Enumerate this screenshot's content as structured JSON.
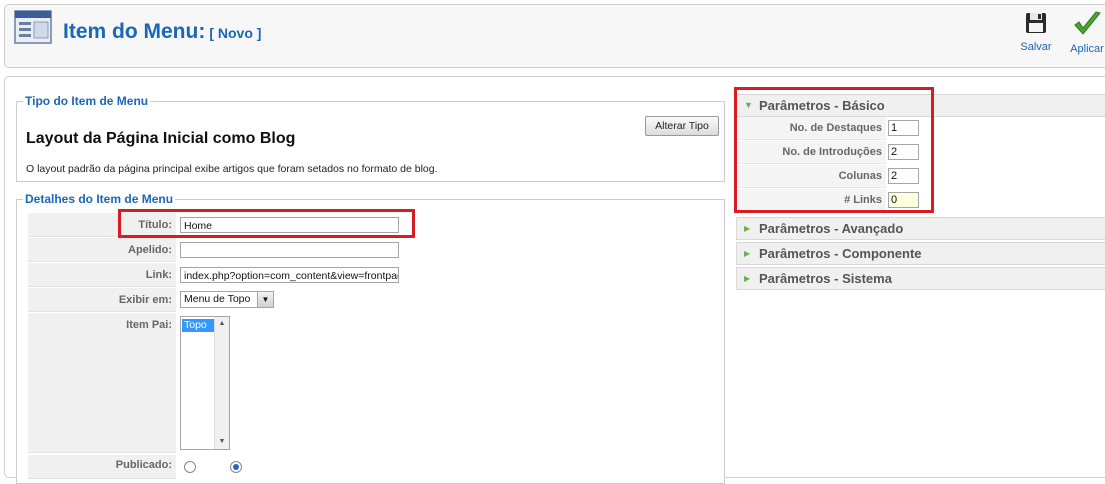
{
  "header": {
    "title": "Item do Menu:",
    "subtitle": "[ Novo ]",
    "save_label": "Salvar",
    "apply_label": "Aplicar"
  },
  "menu_type": {
    "legend": "Tipo do Item de Menu",
    "layout_title": "Layout da Página Inicial como Blog",
    "description": "O layout padrão da página principal exibe artigos que foram setados no formato de blog.",
    "change_button": "Alterar Tipo"
  },
  "details": {
    "legend": "Detalhes do Item de Menu",
    "title_label": "Título:",
    "title_value": "Home",
    "alias_label": "Apelido:",
    "alias_value": "",
    "link_label": "Link:",
    "link_value": "index.php?option=com_content&view=frontpage",
    "display_label": "Exibir em:",
    "display_value": "Menu de Topo",
    "parent_label": "Item Pai:",
    "parent_option": "Topo",
    "published_label": "Publicado:"
  },
  "params_basic": {
    "title": "Parâmetros - Básico",
    "fields": [
      {
        "label": "No. de Destaques",
        "value": "1"
      },
      {
        "label": "No. de Introduções",
        "value": "2"
      },
      {
        "label": "Colunas",
        "value": "2"
      },
      {
        "label": "# Links",
        "value": "0"
      }
    ]
  },
  "collapsed_panels": [
    "Parâmetros - Avançado",
    "Parâmetros - Componente",
    "Parâmetros - Sistema"
  ],
  "colors": {
    "accent": "#1a66b8",
    "highlight": "#d81c24"
  }
}
